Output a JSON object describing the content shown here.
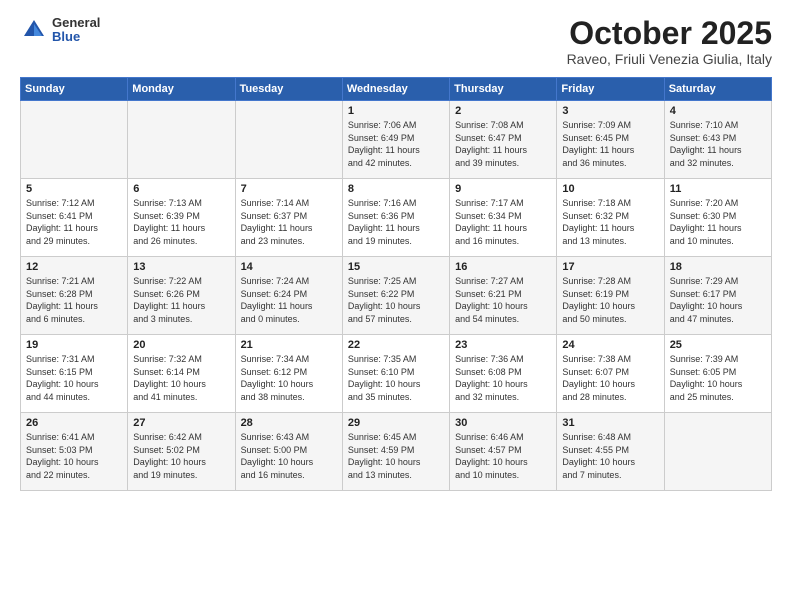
{
  "logo": {
    "general": "General",
    "blue": "Blue"
  },
  "title": "October 2025",
  "subtitle": "Raveo, Friuli Venezia Giulia, Italy",
  "days_of_week": [
    "Sunday",
    "Monday",
    "Tuesday",
    "Wednesday",
    "Thursday",
    "Friday",
    "Saturday"
  ],
  "weeks": [
    [
      {
        "day": "",
        "info": ""
      },
      {
        "day": "",
        "info": ""
      },
      {
        "day": "",
        "info": ""
      },
      {
        "day": "1",
        "info": "Sunrise: 7:06 AM\nSunset: 6:49 PM\nDaylight: 11 hours\nand 42 minutes."
      },
      {
        "day": "2",
        "info": "Sunrise: 7:08 AM\nSunset: 6:47 PM\nDaylight: 11 hours\nand 39 minutes."
      },
      {
        "day": "3",
        "info": "Sunrise: 7:09 AM\nSunset: 6:45 PM\nDaylight: 11 hours\nand 36 minutes."
      },
      {
        "day": "4",
        "info": "Sunrise: 7:10 AM\nSunset: 6:43 PM\nDaylight: 11 hours\nand 32 minutes."
      }
    ],
    [
      {
        "day": "5",
        "info": "Sunrise: 7:12 AM\nSunset: 6:41 PM\nDaylight: 11 hours\nand 29 minutes."
      },
      {
        "day": "6",
        "info": "Sunrise: 7:13 AM\nSunset: 6:39 PM\nDaylight: 11 hours\nand 26 minutes."
      },
      {
        "day": "7",
        "info": "Sunrise: 7:14 AM\nSunset: 6:37 PM\nDaylight: 11 hours\nand 23 minutes."
      },
      {
        "day": "8",
        "info": "Sunrise: 7:16 AM\nSunset: 6:36 PM\nDaylight: 11 hours\nand 19 minutes."
      },
      {
        "day": "9",
        "info": "Sunrise: 7:17 AM\nSunset: 6:34 PM\nDaylight: 11 hours\nand 16 minutes."
      },
      {
        "day": "10",
        "info": "Sunrise: 7:18 AM\nSunset: 6:32 PM\nDaylight: 11 hours\nand 13 minutes."
      },
      {
        "day": "11",
        "info": "Sunrise: 7:20 AM\nSunset: 6:30 PM\nDaylight: 11 hours\nand 10 minutes."
      }
    ],
    [
      {
        "day": "12",
        "info": "Sunrise: 7:21 AM\nSunset: 6:28 PM\nDaylight: 11 hours\nand 6 minutes."
      },
      {
        "day": "13",
        "info": "Sunrise: 7:22 AM\nSunset: 6:26 PM\nDaylight: 11 hours\nand 3 minutes."
      },
      {
        "day": "14",
        "info": "Sunrise: 7:24 AM\nSunset: 6:24 PM\nDaylight: 11 hours\nand 0 minutes."
      },
      {
        "day": "15",
        "info": "Sunrise: 7:25 AM\nSunset: 6:22 PM\nDaylight: 10 hours\nand 57 minutes."
      },
      {
        "day": "16",
        "info": "Sunrise: 7:27 AM\nSunset: 6:21 PM\nDaylight: 10 hours\nand 54 minutes."
      },
      {
        "day": "17",
        "info": "Sunrise: 7:28 AM\nSunset: 6:19 PM\nDaylight: 10 hours\nand 50 minutes."
      },
      {
        "day": "18",
        "info": "Sunrise: 7:29 AM\nSunset: 6:17 PM\nDaylight: 10 hours\nand 47 minutes."
      }
    ],
    [
      {
        "day": "19",
        "info": "Sunrise: 7:31 AM\nSunset: 6:15 PM\nDaylight: 10 hours\nand 44 minutes."
      },
      {
        "day": "20",
        "info": "Sunrise: 7:32 AM\nSunset: 6:14 PM\nDaylight: 10 hours\nand 41 minutes."
      },
      {
        "day": "21",
        "info": "Sunrise: 7:34 AM\nSunset: 6:12 PM\nDaylight: 10 hours\nand 38 minutes."
      },
      {
        "day": "22",
        "info": "Sunrise: 7:35 AM\nSunset: 6:10 PM\nDaylight: 10 hours\nand 35 minutes."
      },
      {
        "day": "23",
        "info": "Sunrise: 7:36 AM\nSunset: 6:08 PM\nDaylight: 10 hours\nand 32 minutes."
      },
      {
        "day": "24",
        "info": "Sunrise: 7:38 AM\nSunset: 6:07 PM\nDaylight: 10 hours\nand 28 minutes."
      },
      {
        "day": "25",
        "info": "Sunrise: 7:39 AM\nSunset: 6:05 PM\nDaylight: 10 hours\nand 25 minutes."
      }
    ],
    [
      {
        "day": "26",
        "info": "Sunrise: 6:41 AM\nSunset: 5:03 PM\nDaylight: 10 hours\nand 22 minutes."
      },
      {
        "day": "27",
        "info": "Sunrise: 6:42 AM\nSunset: 5:02 PM\nDaylight: 10 hours\nand 19 minutes."
      },
      {
        "day": "28",
        "info": "Sunrise: 6:43 AM\nSunset: 5:00 PM\nDaylight: 10 hours\nand 16 minutes."
      },
      {
        "day": "29",
        "info": "Sunrise: 6:45 AM\nSunset: 4:59 PM\nDaylight: 10 hours\nand 13 minutes."
      },
      {
        "day": "30",
        "info": "Sunrise: 6:46 AM\nSunset: 4:57 PM\nDaylight: 10 hours\nand 10 minutes."
      },
      {
        "day": "31",
        "info": "Sunrise: 6:48 AM\nSunset: 4:55 PM\nDaylight: 10 hours\nand 7 minutes."
      },
      {
        "day": "",
        "info": ""
      }
    ]
  ]
}
